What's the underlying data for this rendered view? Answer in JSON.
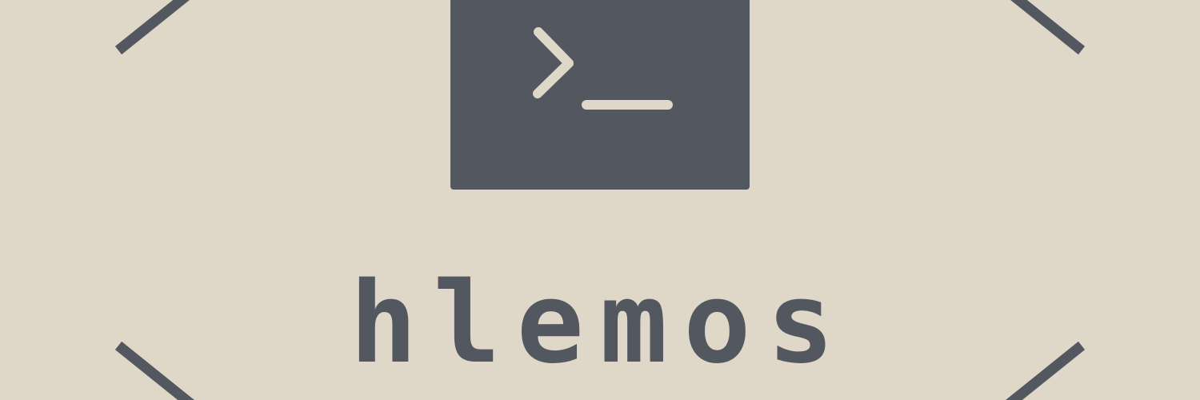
{
  "brand": {
    "name": "hlemos"
  },
  "colors": {
    "background": "#dfd7c8",
    "foreground": "#535860"
  },
  "icons": {
    "terminal": "terminal-prompt-icon",
    "corner": "corner-line-icon"
  }
}
